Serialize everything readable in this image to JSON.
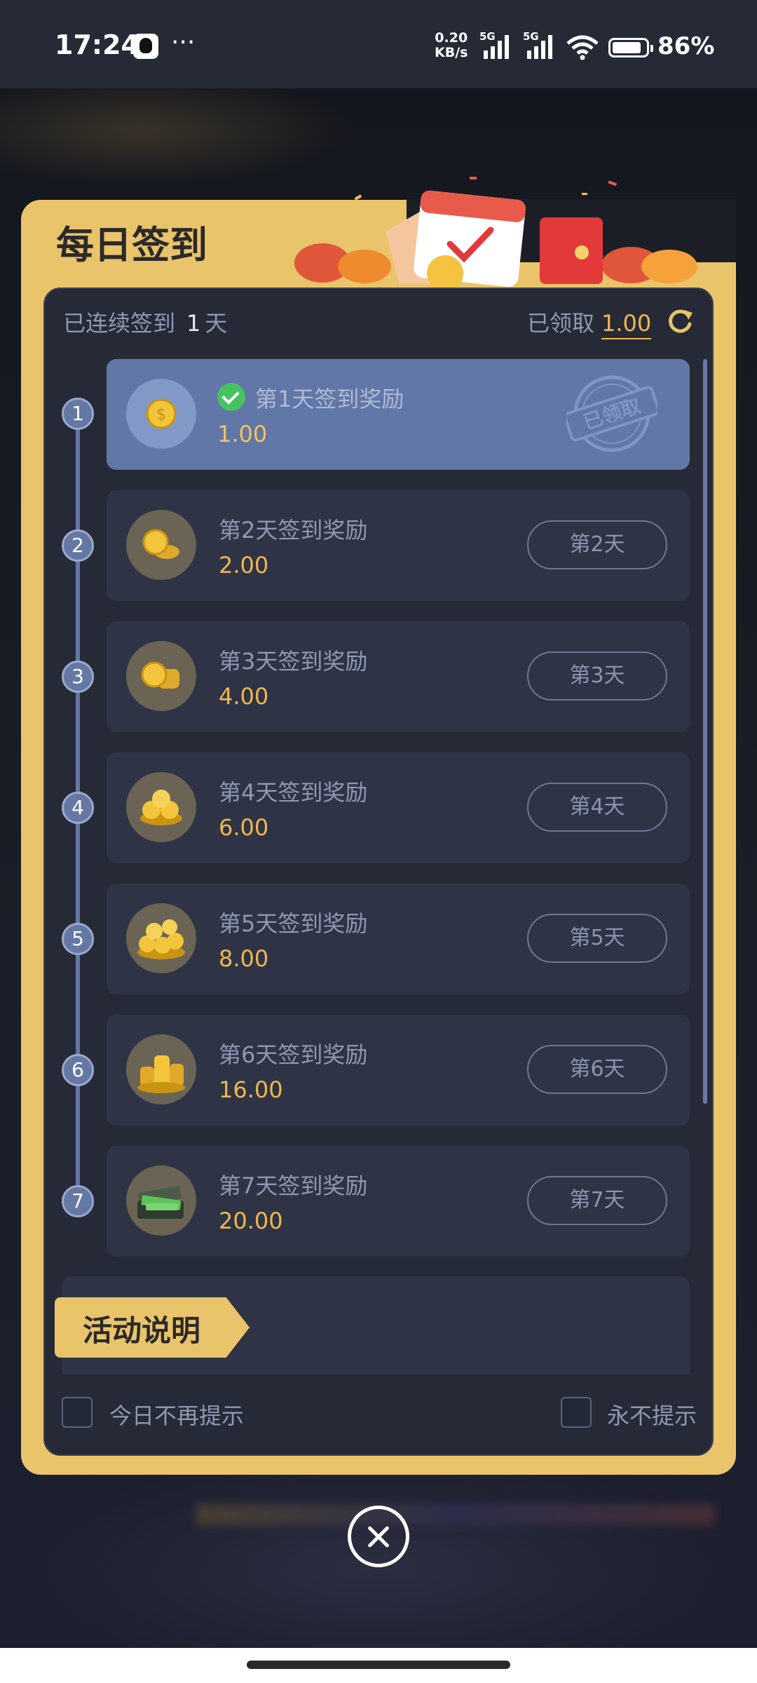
{
  "status_bar": {
    "time": "17:24",
    "net_speed_value": "0.20",
    "net_speed_unit": "KB/s",
    "signal1_label": "5G",
    "signal2_label": "5G",
    "battery": "86%"
  },
  "dialog": {
    "title": "每日签到",
    "streak_prefix": "已连续签到",
    "streak_days": "1",
    "streak_suffix": "天",
    "received_label": "已领取",
    "received_amount": "1.00"
  },
  "rewards": [
    {
      "step": "1",
      "title": "第1天签到奖励",
      "amount": "1.00",
      "status": "已领取"
    },
    {
      "step": "2",
      "title": "第2天签到奖励",
      "amount": "2.00",
      "button": "第2天"
    },
    {
      "step": "3",
      "title": "第3天签到奖励",
      "amount": "4.00",
      "button": "第3天"
    },
    {
      "step": "4",
      "title": "第4天签到奖励",
      "amount": "6.00",
      "button": "第4天"
    },
    {
      "step": "5",
      "title": "第5天签到奖励",
      "amount": "8.00",
      "button": "第5天"
    },
    {
      "step": "6",
      "title": "第6天签到奖励",
      "amount": "16.00",
      "button": "第6天"
    },
    {
      "step": "7",
      "title": "第7天签到奖励",
      "amount": "20.00",
      "button": "第7天"
    }
  ],
  "activity": {
    "label": "活动说明"
  },
  "options": {
    "today_no_remind": "今日不再提示",
    "never_remind": "永不提示"
  },
  "colors": {
    "gold": "#e9c46a",
    "panel": "#252a36",
    "card": "#2e3445",
    "claimed_card": "#6177a7",
    "amount": "#f0b64e",
    "check": "#46c35f"
  }
}
